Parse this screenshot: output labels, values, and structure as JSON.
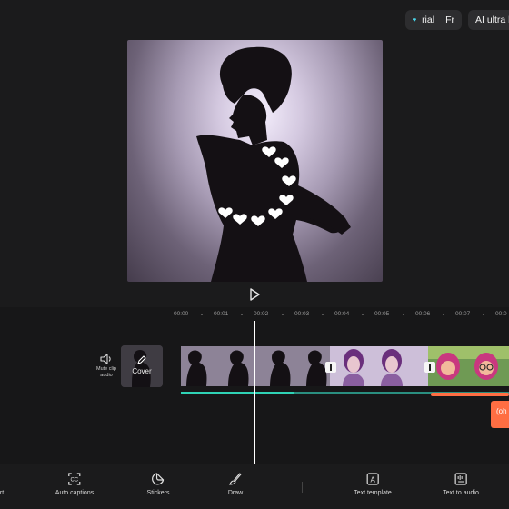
{
  "header": {
    "trial_text": "rial",
    "free_text": "Fr",
    "ultra_text": "AI ultra h"
  },
  "timeline": {
    "ruler": [
      "00:00",
      "00:01",
      "00:02",
      "00:03",
      "00:04",
      "00:05",
      "00:06",
      "00:07",
      "00:0"
    ],
    "mute_label": "Mute clip audio",
    "cover_label": "Cover",
    "text_clip_label": "(oh"
  },
  "toolbar": {
    "items": [
      {
        "label": "rt",
        "icon": "cut-icon"
      },
      {
        "label": "Auto captions",
        "icon": "captions-icon"
      },
      {
        "label": "Stickers",
        "icon": "sticker-icon"
      },
      {
        "label": "Draw",
        "icon": "brush-icon"
      },
      {
        "label": "Text template",
        "icon": "text-template-icon"
      },
      {
        "label": "Text to audio",
        "icon": "text-to-audio-icon"
      }
    ]
  },
  "colors": {
    "accent_orange": "#ff6e43",
    "accent_teal": "#2fd3b5",
    "background": "#1b1b1c"
  }
}
